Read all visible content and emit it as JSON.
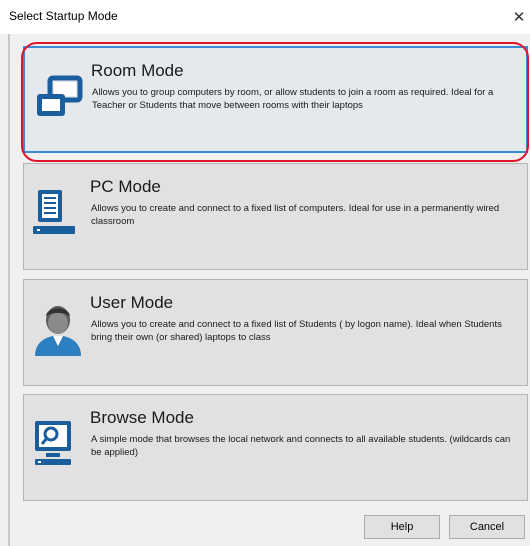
{
  "window": {
    "title": "Select Startup Mode",
    "close_glyph": "✕"
  },
  "modes": [
    {
      "title": "Room Mode",
      "description": "Allows you to group computers by room, or allow students to join a room as required. Ideal for a Teacher or Students that move between rooms with their laptops",
      "icon": "room-mode-icon",
      "selected": true
    },
    {
      "title": "PC Mode",
      "description": "Allows you to create and connect to a fixed list of computers. Ideal for use in a permanently wired classroom",
      "icon": "pc-mode-icon",
      "selected": false
    },
    {
      "title": "User Mode",
      "description": "Allows you to create and connect to a fixed list of Students ( by logon name). Ideal when Students bring their own (or shared) laptops to class",
      "icon": "user-mode-icon",
      "selected": false
    },
    {
      "title": "Browse Mode",
      "description": "A simple mode that browses the local network and connects to all available students. (wildcards can be applied)",
      "icon": "browse-mode-icon",
      "selected": false
    }
  ],
  "buttons": {
    "help": "Help",
    "cancel": "Cancel"
  },
  "colors": {
    "icon_blue": "#1b5e9e",
    "selection_border": "#3a8ad6",
    "annotation_red": "#e0142c"
  }
}
